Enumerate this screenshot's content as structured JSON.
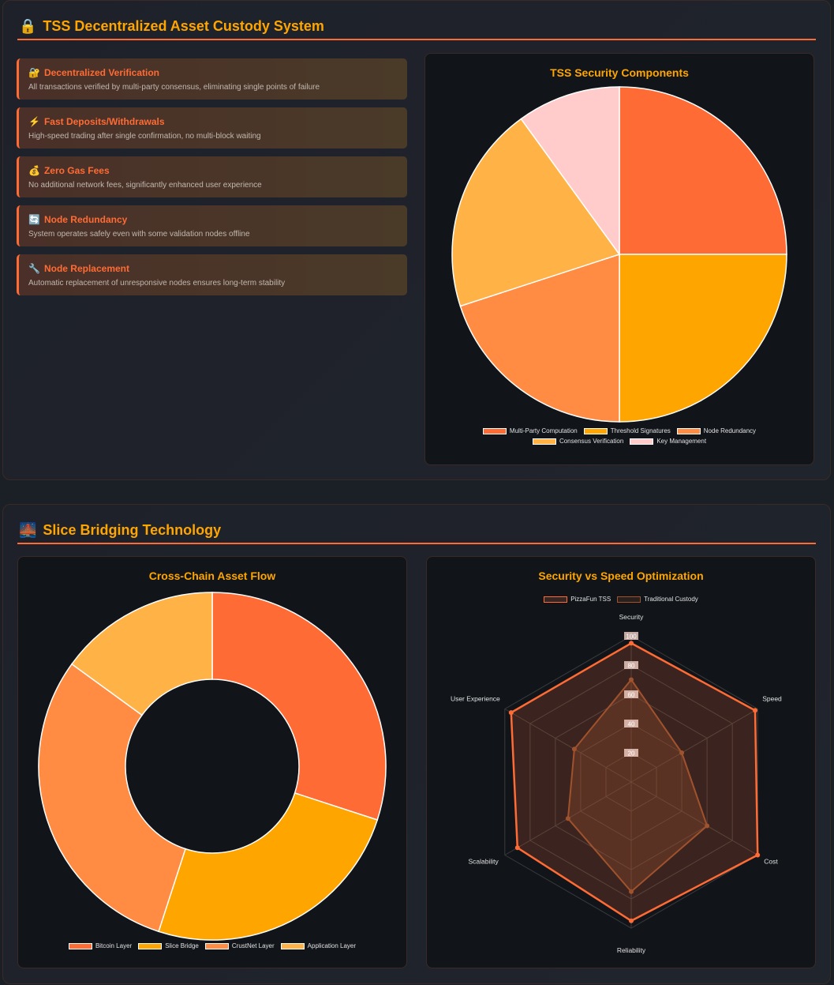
{
  "section1": {
    "icon": "lock-icon",
    "icon_glyph": "🔒",
    "title": "TSS Decentralized Asset Custody System",
    "features": [
      {
        "icon": "lock-with-key-icon",
        "glyph": "🔐",
        "title": "Decentralized Verification",
        "desc": "All transactions verified by multi-party consensus, eliminating single points of failure"
      },
      {
        "icon": "lightning-icon",
        "glyph": "⚡",
        "title": "Fast Deposits/Withdrawals",
        "desc": "High-speed trading after single confirmation, no multi-block waiting"
      },
      {
        "icon": "money-bag-icon",
        "glyph": "💰",
        "title": "Zero Gas Fees",
        "desc": "No additional network fees, significantly enhanced user experience"
      },
      {
        "icon": "refresh-icon",
        "glyph": "🔄",
        "title": "Node Redundancy",
        "desc": "System operates safely even with some validation nodes offline"
      },
      {
        "icon": "wrench-icon",
        "glyph": "🔧",
        "title": "Node Replacement",
        "desc": "Automatic replacement of unresponsive nodes ensures long-term stability"
      }
    ]
  },
  "section2": {
    "icon": "bridge-icon",
    "icon_glyph": "🌉",
    "title": "Slice Bridging Technology"
  },
  "chart_data": [
    {
      "type": "pie",
      "title": "TSS Security Components",
      "categories": [
        "Multi-Party Computation",
        "Threshold Signatures",
        "Node Redundancy",
        "Consensus Verification",
        "Key Management"
      ],
      "values": [
        25,
        25,
        20,
        20,
        10
      ],
      "colors": [
        "#ff6b35",
        "#ffa500",
        "#ff8c42",
        "#ffb347",
        "#ffcccb"
      ],
      "legend": "bottom"
    },
    {
      "type": "doughnut",
      "title": "Cross-Chain Asset Flow",
      "categories": [
        "Bitcoin Layer",
        "Slice Bridge",
        "CrustNet Layer",
        "Application Layer"
      ],
      "values": [
        30,
        25,
        30,
        15
      ],
      "colors": [
        "#ff6b35",
        "#ffa500",
        "#ff8c42",
        "#ffb347"
      ],
      "legend": "bottom"
    },
    {
      "type": "radar",
      "title": "Security vs Speed Optimization",
      "categories": [
        "Security",
        "Speed",
        "Cost",
        "Reliability",
        "Scalability",
        "User Experience"
      ],
      "rlim": [
        0,
        100
      ],
      "ticks": [
        "20",
        "40",
        "60",
        "80",
        "100"
      ],
      "legend": "top",
      "series": [
        {
          "name": "PizzaFun TSS",
          "values": [
            95,
            98,
            100,
            95,
            90,
            95
          ],
          "color": "#ff6b35"
        },
        {
          "name": "Traditional Custody",
          "values": [
            70,
            40,
            60,
            75,
            50,
            45
          ],
          "color": "#a0522d"
        }
      ]
    }
  ]
}
